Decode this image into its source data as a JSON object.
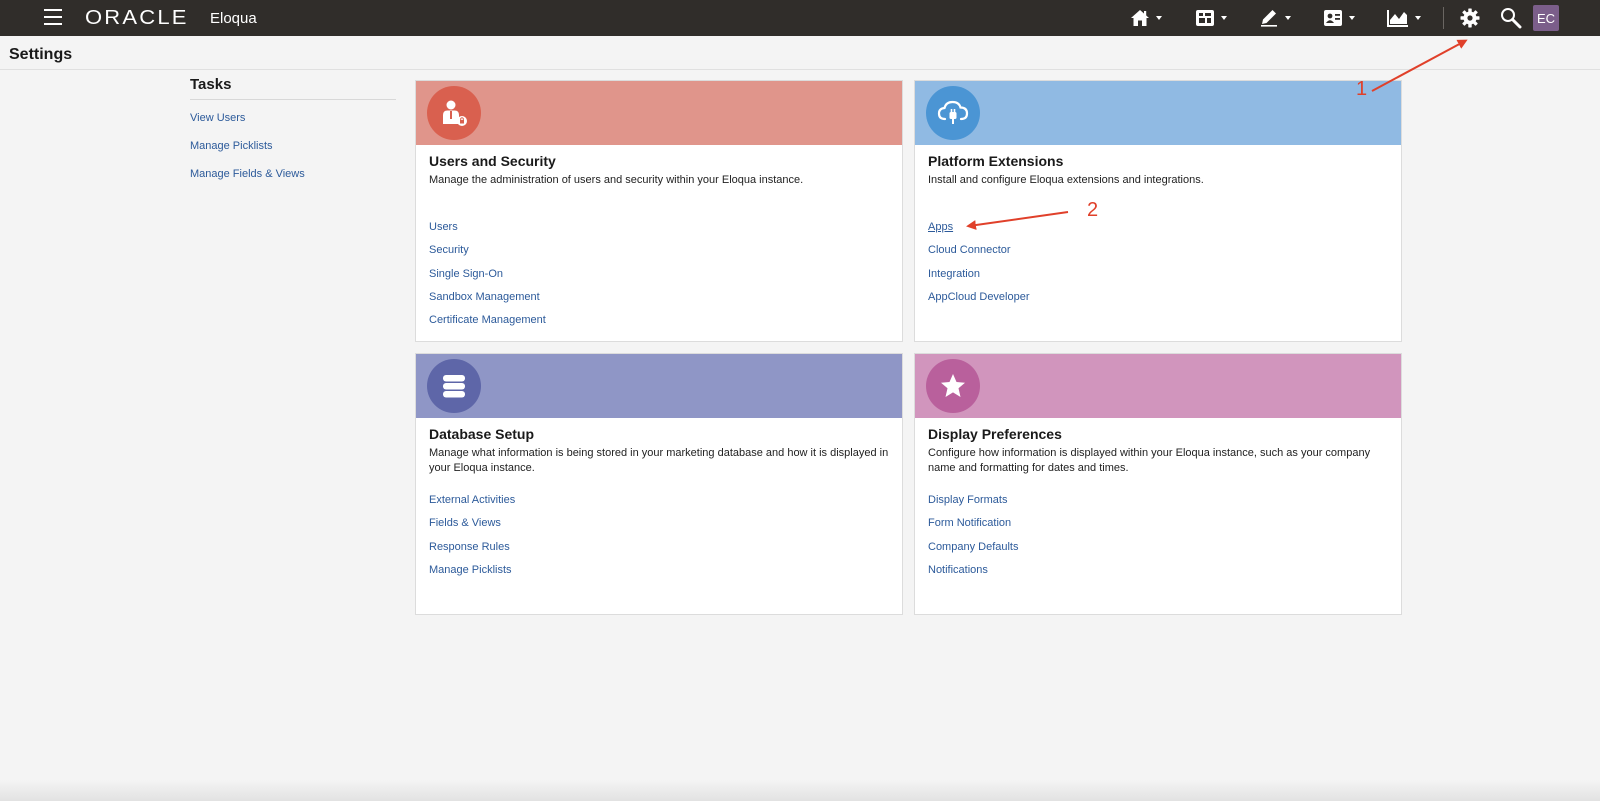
{
  "topbar": {
    "logo": "ORACLE",
    "product": "Eloqua",
    "avatar_initials": "EC",
    "nav_icons": [
      "home-icon",
      "assets-icon",
      "edit-icon",
      "contacts-icon",
      "analytics-icon",
      "gear-icon",
      "search-icon"
    ]
  },
  "page": {
    "title": "Settings"
  },
  "tasks": {
    "title": "Tasks",
    "links": [
      "View Users",
      "Manage Picklists",
      "Manage Fields & Views"
    ]
  },
  "cards": [
    {
      "id": "users-security",
      "title": "Users and Security",
      "description": "Manage the administration of users and security within your Eloqua instance.",
      "header_color": "#e0958b",
      "icon_color": "#d9604f",
      "icon": "user-lock-icon",
      "links": [
        "Users",
        "Security",
        "Single Sign-On",
        "Sandbox Management",
        "Certificate Management"
      ]
    },
    {
      "id": "platform-extensions",
      "title": "Platform Extensions",
      "description": "Install and configure Eloqua extensions and integrations.",
      "header_color": "#90bae3",
      "icon_color": "#4b95d4",
      "icon": "cloud-plug-icon",
      "links": [
        "Apps",
        "Cloud Connector",
        "Integration",
        "AppCloud Developer"
      ]
    },
    {
      "id": "database-setup",
      "title": "Database Setup",
      "description": "Manage what information is being stored in your marketing database and how it is displayed in your Eloqua instance.",
      "header_color": "#8f96c6",
      "icon_color": "#5e66a8",
      "icon": "database-icon",
      "links": [
        "External Activities",
        "Fields & Views",
        "Response Rules",
        "Manage Picklists"
      ]
    },
    {
      "id": "display-preferences",
      "title": "Display Preferences",
      "description": "Configure how information is displayed within your Eloqua instance, such as your company name and formatting for dates and times.",
      "header_color": "#d195bd",
      "icon_color": "#b9609c",
      "icon": "star-icon",
      "links": [
        "Display Formats",
        "Form Notification",
        "Company Defaults",
        "Notifications"
      ]
    }
  ],
  "annotations": {
    "marker_1": "1",
    "marker_2": "2",
    "color": "#e0402a"
  }
}
